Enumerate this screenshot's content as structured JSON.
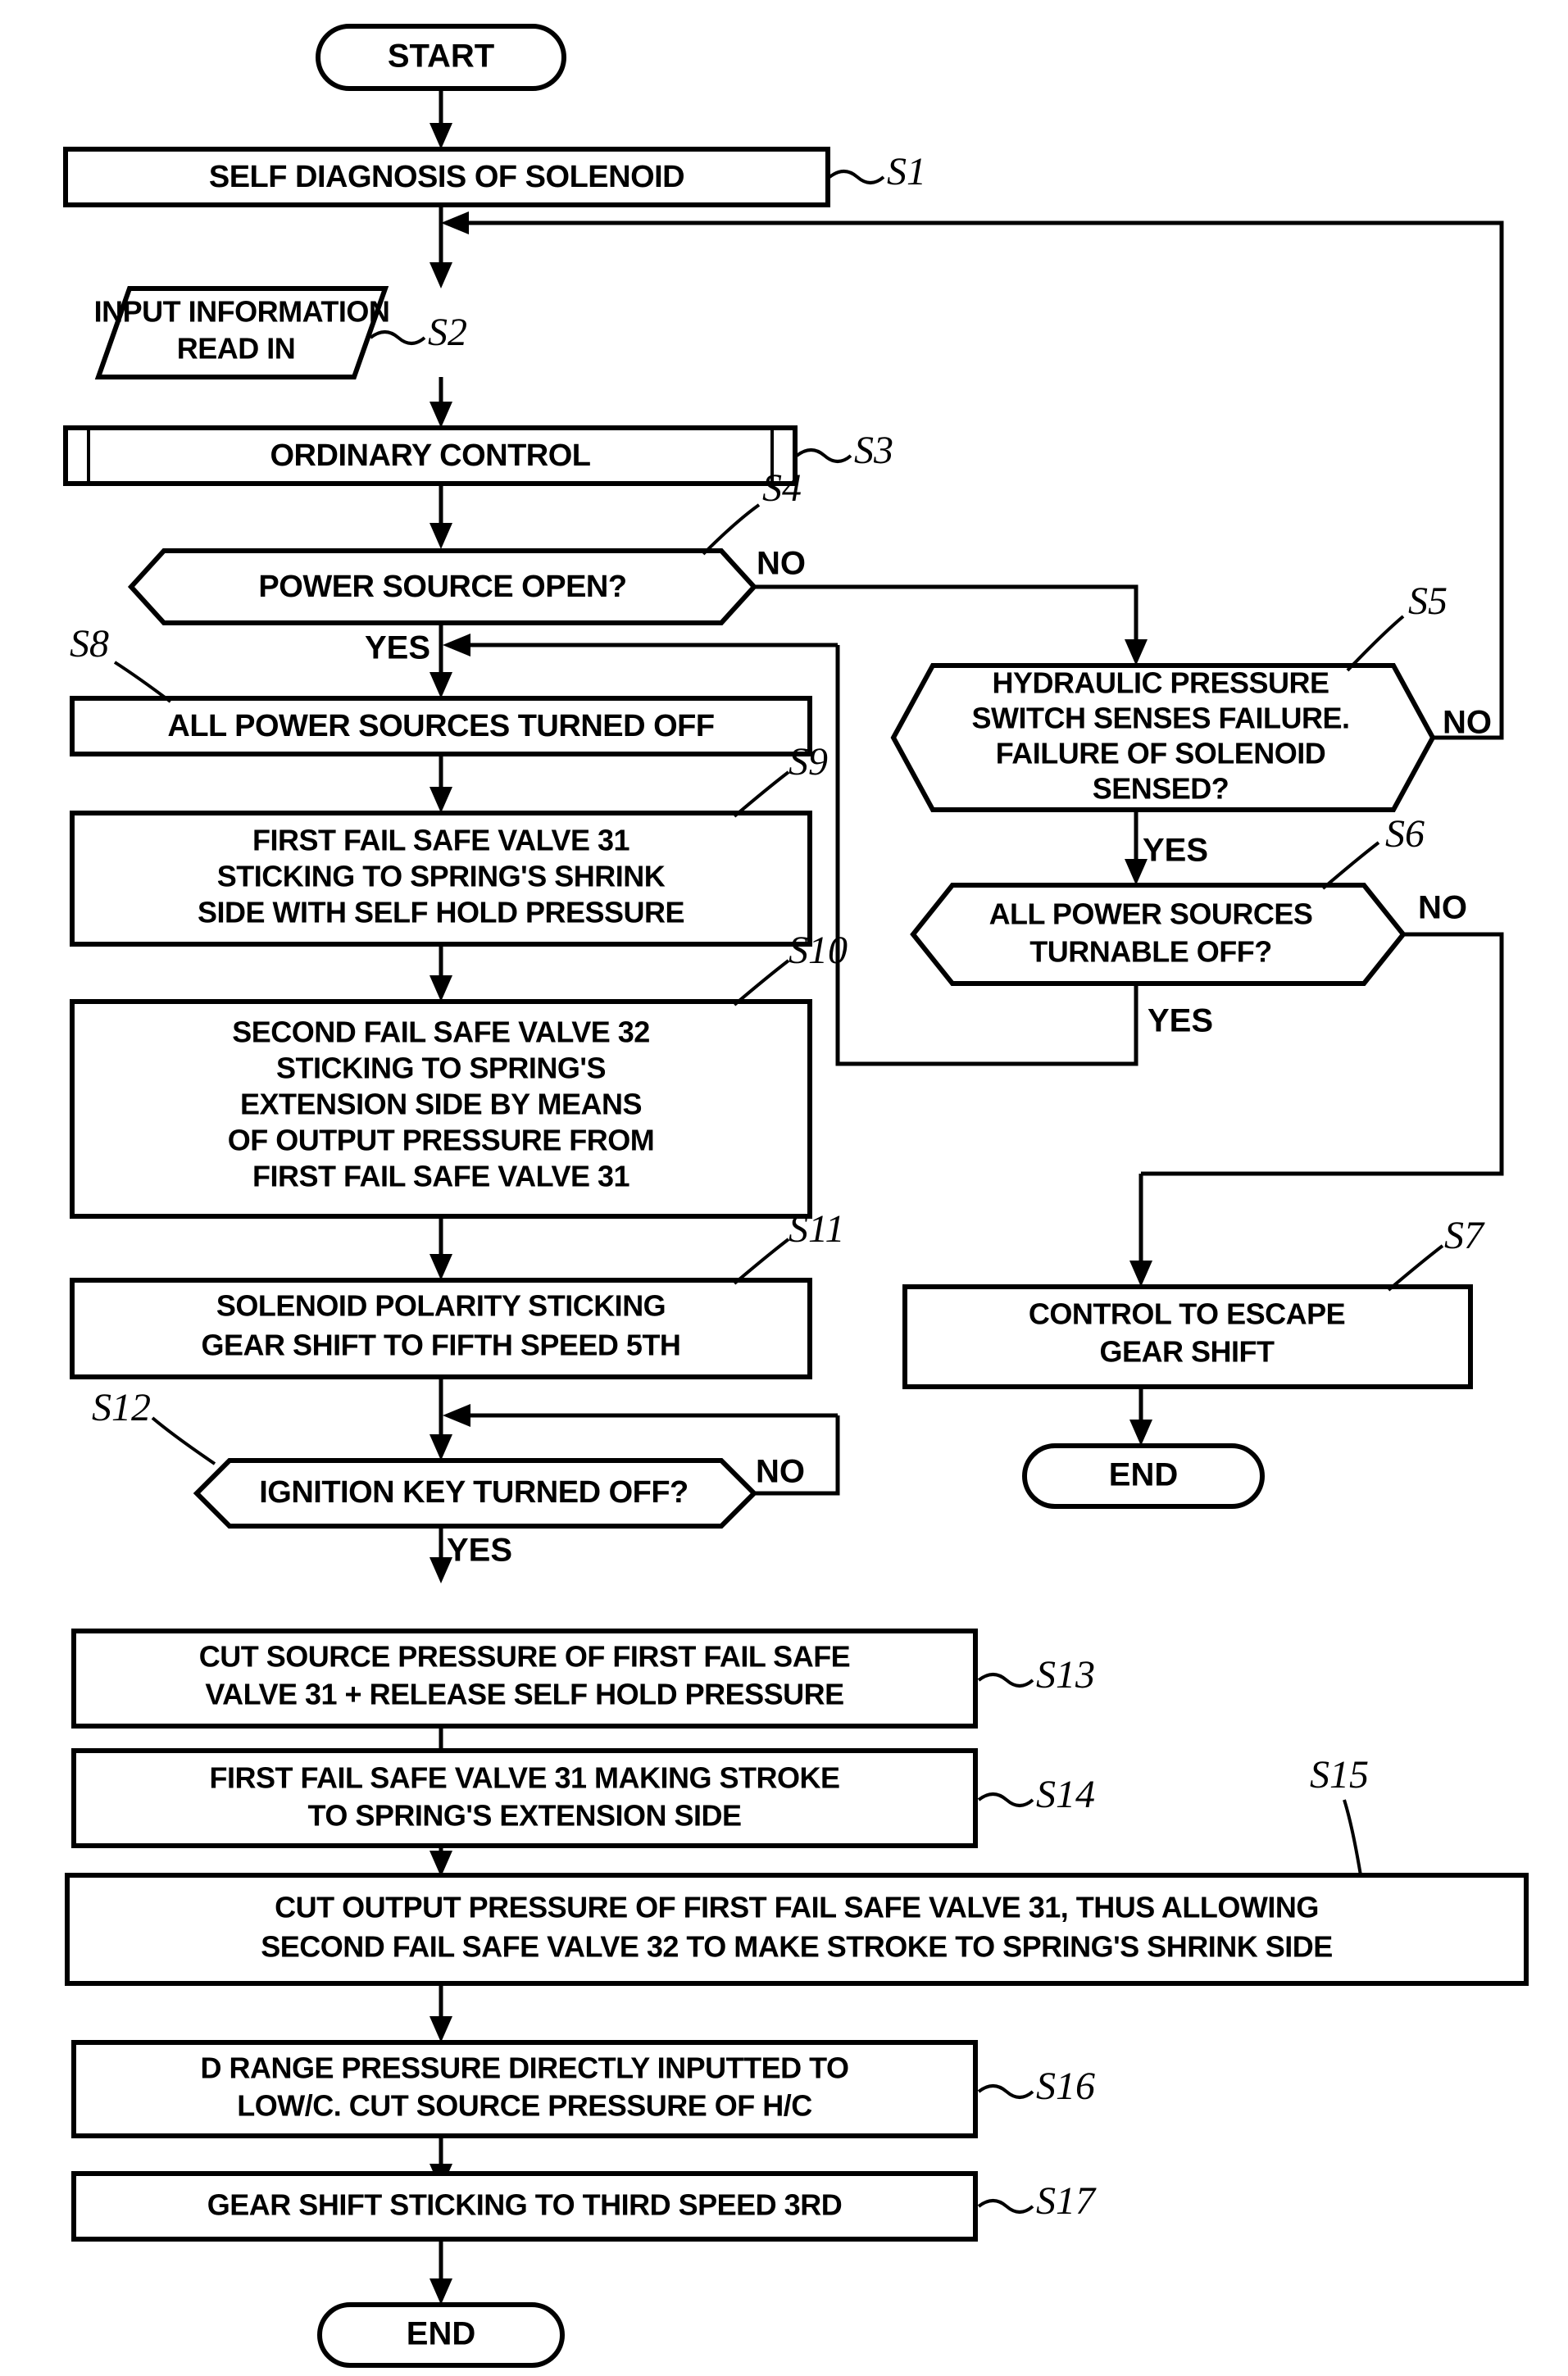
{
  "figure": {
    "type": "flowchart",
    "title": "Fail safe control flowchart",
    "background_color": "#ffffff",
    "line_color": "#000000"
  },
  "nodes": {
    "start": {
      "label": "START",
      "shape": "terminator"
    },
    "s1": {
      "step": "S1",
      "label": "SELF DIAGNOSIS OF SOLENOID",
      "shape": "process"
    },
    "s2": {
      "step": "S2",
      "line1": "INPUT INFORMATION",
      "line2": "READ IN",
      "shape": "parallelogram"
    },
    "s3": {
      "step": "S3",
      "label": "ORDINARY CONTROL",
      "shape": "predefined-process"
    },
    "s4": {
      "step": "S4",
      "label": "POWER SOURCE OPEN?",
      "shape": "hexagon-decision"
    },
    "s5": {
      "step": "S5",
      "line1": "HYDRAULIC PRESSURE",
      "line2": "SWITCH SENSES FAILURE.",
      "line3": "FAILURE OF SOLENOID",
      "line4": "SENSED?",
      "shape": "hexagon-decision"
    },
    "s6": {
      "step": "S6",
      "line1": "ALL POWER SOURCES",
      "line2": "TURNABLE OFF?",
      "shape": "hexagon-decision"
    },
    "s7": {
      "step": "S7",
      "line1": "CONTROL TO ESCAPE",
      "line2": "GEAR SHIFT",
      "shape": "process"
    },
    "end_right": {
      "label": "END",
      "shape": "terminator"
    },
    "s8": {
      "step": "S8",
      "label": "ALL POWER SOURCES TURNED OFF",
      "shape": "process"
    },
    "s9": {
      "step": "S9",
      "line1": "FIRST FAIL SAFE VALVE 31",
      "line2": "STICKING TO SPRING'S SHRINK",
      "line3": "SIDE WITH SELF HOLD PRESSURE",
      "shape": "process"
    },
    "s10": {
      "step": "S10",
      "line1": "SECOND FAIL SAFE VALVE 32",
      "line2": "STICKING TO SPRING'S",
      "line3": "EXTENSION SIDE BY MEANS",
      "line4": "OF OUTPUT PRESSURE FROM",
      "line5": "FIRST FAIL SAFE VALVE 31",
      "shape": "process"
    },
    "s11": {
      "step": "S11",
      "line1": "SOLENOID POLARITY STICKING",
      "line2": "GEAR SHIFT TO FIFTH SPEED 5TH",
      "shape": "process"
    },
    "s12": {
      "step": "S12",
      "label": "IGNITION KEY TURNED OFF?",
      "shape": "hexagon-decision"
    },
    "s13": {
      "step": "S13",
      "line1": "CUT SOURCE PRESSURE OF FIRST FAIL SAFE",
      "line2": "VALVE 31 + RELEASE SELF HOLD PRESSURE",
      "shape": "process"
    },
    "s14": {
      "step": "S14",
      "line1": "FIRST FAIL SAFE VALVE 31 MAKING STROKE",
      "line2": "TO SPRING'S EXTENSION SIDE",
      "shape": "process"
    },
    "s15": {
      "step": "S15",
      "line1": "CUT OUTPUT PRESSURE OF FIRST FAIL SAFE VALVE 31, THUS ALLOWING",
      "line2": "SECOND FAIL SAFE VALVE 32 TO MAKE STROKE TO SPRING'S SHRINK SIDE",
      "shape": "process"
    },
    "s16": {
      "step": "S16",
      "line1": "D RANGE PRESSURE DIRECTLY INPUTTED TO",
      "line2": "LOW/C. CUT SOURCE PRESSURE OF H/C",
      "shape": "process"
    },
    "s17": {
      "step": "S17",
      "label": "GEAR SHIFT STICKING TO THIRD SPEED 3RD",
      "shape": "process"
    },
    "end_bottom": {
      "label": "END",
      "shape": "terminator"
    }
  },
  "branch_labels": {
    "s4_no": "NO",
    "s4_yes": "YES",
    "s5_no": "NO",
    "s5_yes": "YES",
    "s6_no": "NO",
    "s6_yes": "YES",
    "s12_no": "NO",
    "s12_yes": "YES"
  }
}
